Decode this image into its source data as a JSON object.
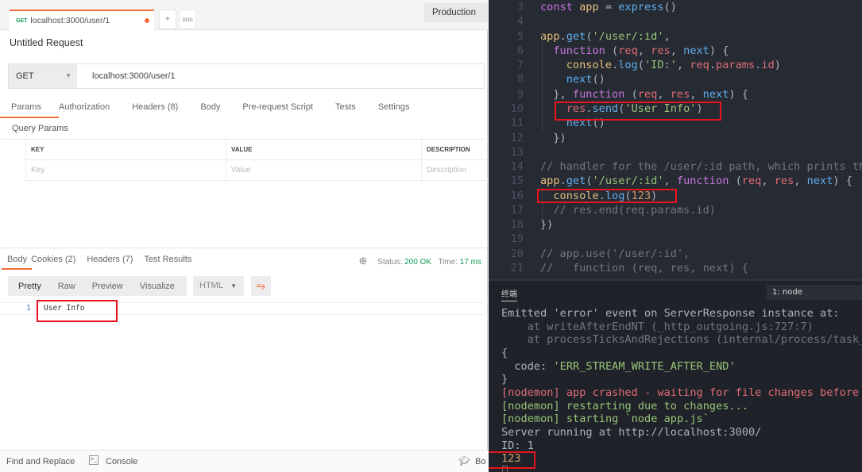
{
  "postman": {
    "tab": {
      "method": "GET",
      "url": "localhost:3000/user/1"
    },
    "new_tab": "+",
    "more_tabs": "ooo",
    "environment": "Production",
    "request_title": "Untitled Request",
    "method": "GET",
    "url": "localhost:3000/user/1",
    "request_tabs": [
      "Params",
      "Authorization",
      "Headers",
      "Body",
      "Pre-request Script",
      "Tests",
      "Settings"
    ],
    "headers_count": "(8)",
    "query_params_label": "Query Params",
    "columns": [
      "KEY",
      "VALUE",
      "DESCRIPTION"
    ],
    "placeholders": [
      "Key",
      "Value",
      "Description"
    ],
    "response_tabs": [
      "Body",
      "Cookies",
      "Headers",
      "Test Results"
    ],
    "cookies_count": "(2)",
    "resp_headers_count": "(7)",
    "status_label": "Status:",
    "status": "200 OK",
    "time_label": "Time:",
    "time": "17 ms",
    "formats": [
      "Pretty",
      "Raw",
      "Preview",
      "Visualize"
    ],
    "language": "HTML",
    "body_line_number": "1",
    "body_text": "User Info",
    "footer": {
      "find": "Find and Replace",
      "console": "Console",
      "bootcamp": "Bo"
    },
    "accent": "#f26b3a"
  },
  "editor": {
    "line_numbers": [
      "3",
      "4",
      "5",
      "6",
      "7",
      "8",
      "9",
      "10",
      "11",
      "12",
      "13",
      "14",
      "15",
      "16",
      "17",
      "18",
      "19",
      "20",
      "21"
    ],
    "lines": [
      [
        [
          "const ",
          "k"
        ],
        [
          "app ",
          "y"
        ],
        [
          "= ",
          "d"
        ],
        [
          "express",
          "f"
        ],
        [
          "()",
          "d"
        ]
      ],
      [],
      [
        [
          "app",
          "y"
        ],
        [
          ".",
          "d"
        ],
        [
          "get",
          "f"
        ],
        [
          "(",
          "d"
        ],
        [
          "'/user/:id'",
          "s"
        ],
        [
          ",",
          "d"
        ]
      ],
      [
        [
          "  function ",
          "k"
        ],
        [
          "(",
          "d"
        ],
        [
          "req",
          "p"
        ],
        [
          ", ",
          "d"
        ],
        [
          "res",
          "p"
        ],
        [
          ", ",
          "d"
        ],
        [
          "next",
          "f"
        ],
        [
          ") {",
          "d"
        ]
      ],
      [
        [
          "    console",
          "y"
        ],
        [
          ".",
          "d"
        ],
        [
          "log",
          "f"
        ],
        [
          "(",
          "d"
        ],
        [
          "'ID:'",
          "s"
        ],
        [
          ", ",
          "d"
        ],
        [
          "req",
          "p"
        ],
        [
          ".",
          "d"
        ],
        [
          "params",
          "p"
        ],
        [
          ".",
          "d"
        ],
        [
          "id",
          "p"
        ],
        [
          ")",
          "d"
        ]
      ],
      [
        [
          "    next",
          "f"
        ],
        [
          "()",
          "d"
        ]
      ],
      [
        [
          "  }, ",
          "d"
        ],
        [
          "function ",
          "k"
        ],
        [
          "(",
          "d"
        ],
        [
          "req",
          "p"
        ],
        [
          ", ",
          "d"
        ],
        [
          "res",
          "p"
        ],
        [
          ", ",
          "d"
        ],
        [
          "next",
          "f"
        ],
        [
          ") {",
          "d"
        ]
      ],
      [
        [
          "    res",
          "p"
        ],
        [
          ".",
          "d"
        ],
        [
          "send",
          "f"
        ],
        [
          "(",
          "d"
        ],
        [
          "'User Info'",
          "s"
        ],
        [
          ")",
          "d"
        ]
      ],
      [
        [
          "    next",
          "f"
        ],
        [
          "()",
          "d"
        ]
      ],
      [
        [
          "  })",
          "d"
        ]
      ],
      [],
      [
        [
          "// handler for the /user/:id path, which prints the user ID",
          "c"
        ]
      ],
      [
        [
          "app",
          "y"
        ],
        [
          ".",
          "d"
        ],
        [
          "get",
          "f"
        ],
        [
          "(",
          "d"
        ],
        [
          "'/user/:id'",
          "s"
        ],
        [
          ", ",
          "d"
        ],
        [
          "function ",
          "k"
        ],
        [
          "(",
          "d"
        ],
        [
          "req",
          "p"
        ],
        [
          ", ",
          "d"
        ],
        [
          "res",
          "p"
        ],
        [
          ", ",
          "d"
        ],
        [
          "next",
          "f"
        ],
        [
          ") {",
          "d"
        ]
      ],
      [
        [
          "  console",
          "y"
        ],
        [
          ".",
          "d"
        ],
        [
          "log",
          "f"
        ],
        [
          "(",
          "d"
        ],
        [
          "123",
          "n"
        ],
        [
          ")",
          "d"
        ]
      ],
      [
        [
          "  // res.end(req.params.id)",
          "c"
        ]
      ],
      [
        [
          "})",
          "d"
        ]
      ],
      [],
      [
        [
          "// app.use('/user/:id',",
          "c"
        ]
      ],
      [
        [
          "//   function (req, res, next) {",
          "c"
        ]
      ]
    ]
  },
  "terminal": {
    "tab_label": "终端",
    "selector": "1: node",
    "lines": [
      [
        [
          "Emitted 'error' event on ServerResponse instance at:",
          "d"
        ]
      ],
      [
        [
          "    at writeAfterEndNT (_http_outgoing.js:727:7)",
          "c"
        ]
      ],
      [
        [
          "    at processTicksAndRejections (internal/process/task_queues.js)",
          "c"
        ]
      ],
      [
        [
          "{",
          "d"
        ]
      ],
      [
        [
          "  code: ",
          "d"
        ],
        [
          "'ERR_STREAM_WRITE_AFTER_END'",
          "s"
        ]
      ],
      [
        [
          "}",
          "d"
        ]
      ],
      [
        [
          "[nodemon] app crashed - waiting for file changes before starting...",
          "p"
        ]
      ],
      [
        [
          "[nodemon] restarting due to changes...",
          "s"
        ]
      ],
      [
        [
          "[nodemon] starting `node app.js`",
          "s"
        ]
      ],
      [
        [
          "Server running at http://localhost:3000/",
          "d"
        ]
      ],
      [
        [
          "ID: 1",
          "d"
        ]
      ],
      [
        [
          "123",
          "n"
        ]
      ]
    ]
  }
}
